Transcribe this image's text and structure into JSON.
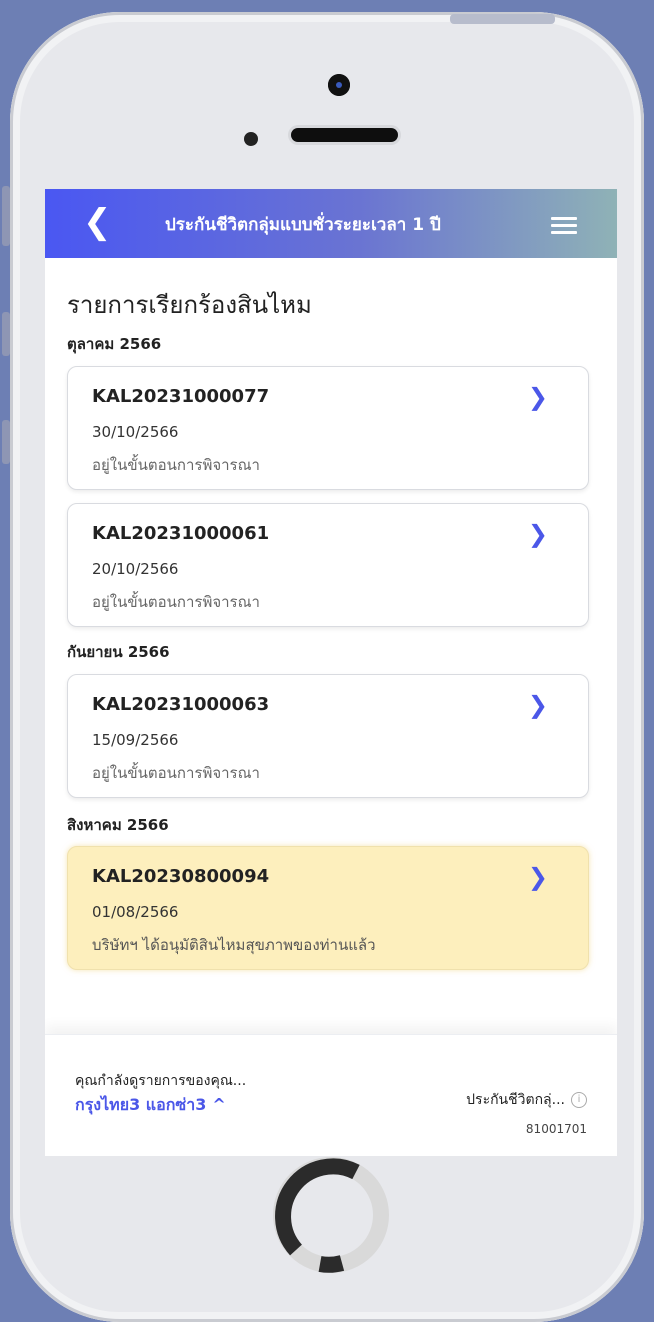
{
  "header": {
    "back_icon": "chevron-left-icon",
    "title": "ประกันชีวิตกลุ่มแบบชั่วระยะเวลา 1 ปี",
    "menu_icon": "hamburger-icon"
  },
  "page_title": "รายการเรียกร้องสินไหม",
  "groups": [
    {
      "month": "ตุลาคม 2566",
      "claims": [
        {
          "id": "KAL20231000077",
          "date": "30/10/2566",
          "status": "อยู่ในขั้นตอนการพิจารณา"
        },
        {
          "id": "KAL20231000061",
          "date": "20/10/2566",
          "status": "อยู่ในขั้นตอนการพิจารณา"
        }
      ]
    },
    {
      "month": "กันยายน 2566",
      "claims": [
        {
          "id": "KAL20231000063",
          "date": "15/09/2566",
          "status": "อยู่ในขั้นตอนการพิจารณา"
        }
      ]
    },
    {
      "month": "สิงหาคม 2566",
      "claims": [
        {
          "id": "KAL20230800094",
          "date": "01/08/2566",
          "status": "บริษัทฯ ได้อนุมัติสินไหมสุขภาพของท่านแล้ว",
          "highlighted": true
        }
      ]
    }
  ],
  "footer": {
    "viewing_label": "คุณกำลังดูรายการของคุณ...",
    "person_name": "กรุงไทย3 แอกซ่า3",
    "person_caret": "^",
    "policy_name": "ประกันชีวิตกลุ่...",
    "policy_number": "81001701"
  },
  "colors": {
    "accent": "#4b57e8",
    "highlight": "#fdefbd",
    "header_gradient_start": "#4a57f2",
    "header_gradient_end": "#8fb2b6"
  }
}
